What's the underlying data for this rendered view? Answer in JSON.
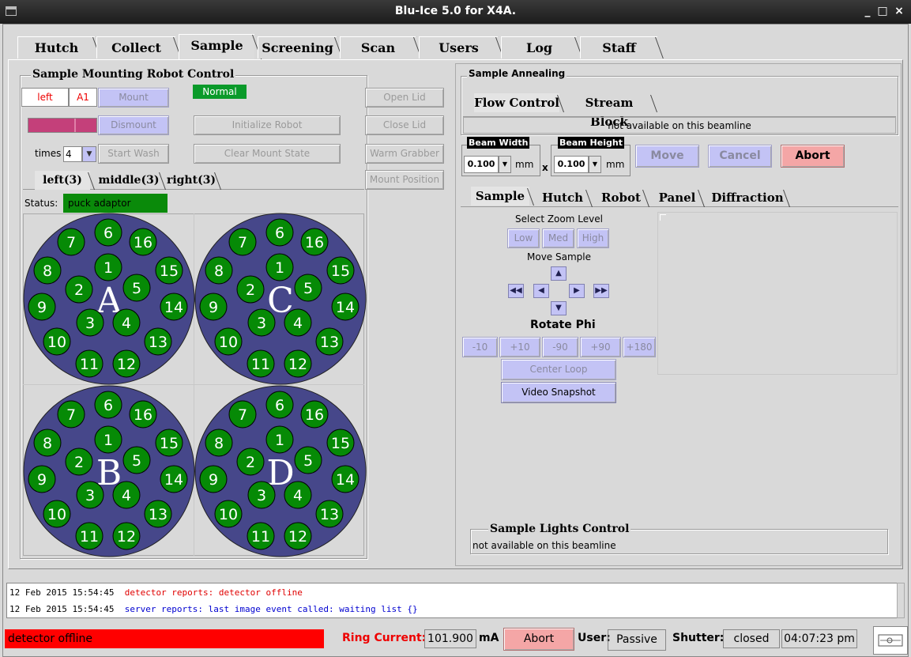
{
  "window": {
    "title": "Blu-Ice 5.0 for X4A.",
    "min": "_",
    "max": "□",
    "close": "×"
  },
  "tabs": [
    "Hutch",
    "Collect",
    "Sample",
    "Screening",
    "Scan",
    "Users",
    "Log",
    "Staff"
  ],
  "selected_tab": "Sample",
  "robot": {
    "title": "Sample Mounting Robot Control",
    "position": "left",
    "port": "A1",
    "mount": "Mount",
    "status_badge": "Normal",
    "dismount": "Dismount",
    "init": "Initialize Robot",
    "open_lid": "Open Lid",
    "close_lid": "Close Lid",
    "times_label": "times",
    "times_value": "4",
    "start_wash": "Start Wash",
    "clear": "Clear Mount State",
    "warm": "Warm Grabber",
    "mount_position": "Mount Position",
    "cassette_tabs": [
      "left(3)",
      "middle(3)",
      "right(3)"
    ],
    "status_label": "Status:",
    "status_value": "puck adaptor",
    "pucks": [
      "A",
      "C",
      "B",
      "D"
    ],
    "ports": [
      "1",
      "2",
      "3",
      "4",
      "5",
      "6",
      "7",
      "8",
      "9",
      "10",
      "11",
      "12",
      "13",
      "14",
      "15",
      "16"
    ]
  },
  "anneal": {
    "title": "Sample Annealing",
    "tabs": [
      "Flow Control",
      "Stream Block"
    ],
    "message": "not available on this beamline",
    "beam_width_label": "Beam Width",
    "beam_width": "0.100",
    "beam_height_label": "Beam Height",
    "beam_height": "0.100",
    "unit": "mm",
    "x": "x",
    "move": "Move",
    "cancel": "Cancel",
    "abort": "Abort"
  },
  "sample_view": {
    "tabs": [
      "Sample",
      "Hutch",
      "Robot",
      "Panel",
      "Diffraction"
    ],
    "zoom_label": "Select Zoom Level",
    "zoom": [
      "Low",
      "Med",
      "High"
    ],
    "move_label": "Move Sample",
    "rotate_label": "Rotate Phi",
    "rotate": [
      "-10",
      "+10",
      "-90",
      "+90",
      "+180"
    ],
    "center": "Center Loop",
    "snapshot": "Video Snapshot"
  },
  "lights": {
    "title": "Sample Lights Control",
    "message": "not available on this beamline"
  },
  "log": [
    {
      "time": "12 Feb 2015 15:54:45",
      "text": "detector reports: detector offline",
      "color": "#e00000"
    },
    {
      "time": "12 Feb 2015 15:54:45",
      "text": "server reports: last image event called: waiting list {}",
      "color": "#0000d0"
    }
  ],
  "status": {
    "message": "detector offline",
    "ring_label": "Ring Current:",
    "ring_value": "101.900",
    "ring_unit": "mA",
    "abort": "Abort",
    "user_label": "User:",
    "user_value": "Passive",
    "shutter_label": "Shutter:",
    "shutter_value": "closed",
    "clock": "04:07:23 pm"
  }
}
